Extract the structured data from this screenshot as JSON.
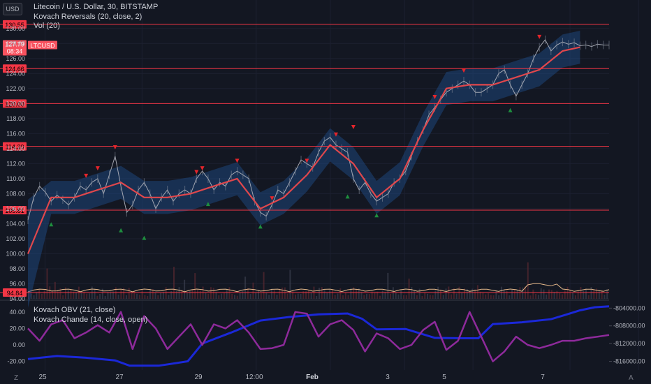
{
  "header": {
    "title": "Litecoin / U.S. Dollar, 30, BITSTAMP",
    "indicator1": "Kovach Reversals (20, close, 2)",
    "indicator2": "Vol (20)",
    "currency_button": "USD"
  },
  "lower_pane": {
    "indicator1": "Kovach OBV (21, close)",
    "indicator2": "Kovach Chande (14, close, open)"
  },
  "corner_buttons": {
    "left": "Z",
    "right": "A"
  },
  "colors": {
    "background": "#131722",
    "level_line": "#f23645",
    "band_fill": "#1f4f8f",
    "price_line": "#b2b5be",
    "ma_line": "#e0474c",
    "sell_marker": "#e5252b",
    "buy_marker": "#1e8e3e",
    "volume_line": "#e5b98a",
    "obv_line": "#1b28d8",
    "chande_line": "#8e2a9b"
  },
  "chart_data": [
    {
      "type": "line",
      "pane": "price",
      "symbol": "LTCUSD",
      "timeframe": "30",
      "x_tick_labels": [
        "25",
        "27",
        "29",
        "12:00",
        "Feb",
        "3",
        "5",
        "7"
      ],
      "y_tick_labels": [
        "94.00",
        "96.00",
        "98.00",
        "100.00",
        "102.00",
        "104.00",
        "106.00",
        "108.00",
        "110.00",
        "112.00",
        "114.00",
        "116.00",
        "118.00",
        "120.00",
        "122.00",
        "124.00",
        "126.00",
        "128.00",
        "130.00"
      ],
      "ylim": [
        94,
        131
      ],
      "price_label": {
        "value": "127.79",
        "countdown": "08:34",
        "symbol": "LTCUSD"
      },
      "levels": [
        130.55,
        124.66,
        120.0,
        114.3,
        105.81,
        94.84
      ],
      "level_labels": [
        "130.55",
        "124.66",
        "120.00",
        "114.30",
        "105.81",
        "94.84"
      ],
      "series": [
        {
          "kind": "close",
          "x": [
            0,
            2,
            4,
            6,
            8,
            10,
            12,
            14,
            16,
            18,
            20,
            22,
            24,
            26,
            28,
            30,
            32,
            34,
            36,
            38,
            40,
            42,
            44,
            46,
            48,
            50,
            52,
            54,
            56,
            58,
            60,
            62,
            64,
            66,
            68,
            70,
            72,
            74,
            76,
            78,
            80,
            82,
            84,
            86,
            88,
            90,
            92,
            94,
            96,
            98,
            100,
            102,
            104,
            106,
            108,
            110,
            112,
            114,
            116,
            118,
            120,
            122,
            124,
            126,
            128,
            130,
            132,
            134,
            136,
            138,
            140,
            142,
            144,
            146,
            148,
            150,
            152,
            154,
            156,
            158,
            160,
            162,
            164,
            166,
            168,
            170,
            172,
            174,
            176,
            178,
            180,
            182,
            184,
            186,
            188,
            190,
            192,
            194,
            196,
            198,
            200
          ],
          "values": [
            104.5,
            107.5,
            109.0,
            108.2,
            107.0,
            107.8,
            107.2,
            106.5,
            107.5,
            109.0,
            108.5,
            109.5,
            110.0,
            108.0,
            110.5,
            113.0,
            109.0,
            105.5,
            106.5,
            108.5,
            109.5,
            108.0,
            106.0,
            107.5,
            108.5,
            107.0,
            108.0,
            108.5,
            108.0,
            110.0,
            111.0,
            110.0,
            108.5,
            109.5,
            109.0,
            110.5,
            111.0,
            110.5,
            110.0,
            107.0,
            105.5,
            105.0,
            106.5,
            108.5,
            108.0,
            109.5,
            111.0,
            112.5,
            112.0,
            111.5,
            113.5,
            115.0,
            115.5,
            114.5,
            114.0,
            113.5,
            110.0,
            108.5,
            109.5,
            108.0,
            107.0,
            107.5,
            108.0,
            109.5,
            110.0,
            111.0,
            113.0,
            115.0,
            116.5,
            118.5,
            119.5,
            120.5,
            121.5,
            122.0,
            122.5,
            123.0,
            122.5,
            121.5,
            121.5,
            122.0,
            122.5,
            124.0,
            124.5,
            122.5,
            121.0,
            122.5,
            124.0,
            126.0,
            127.5,
            128.5,
            127.0,
            127.79,
            128.2,
            127.9,
            128.1,
            127.7,
            127.8,
            127.6,
            127.9,
            127.8,
            127.79
          ]
        },
        {
          "kind": "moving_average",
          "x": [
            0,
            8,
            16,
            24,
            32,
            40,
            48,
            56,
            64,
            72,
            80,
            88,
            96,
            104,
            112,
            120,
            128,
            136,
            144,
            152,
            160,
            168,
            176,
            184,
            190
          ],
          "values": [
            100.0,
            107.5,
            107.5,
            108.5,
            109.5,
            107.5,
            107.5,
            108.0,
            109.0,
            110.0,
            106.0,
            107.5,
            110.5,
            114.5,
            112.0,
            107.5,
            110.0,
            116.5,
            122.0,
            122.5,
            122.5,
            123.5,
            124.5,
            127.0,
            127.5
          ]
        }
      ],
      "sell_markers": [
        {
          "x": 20,
          "y": 110.0
        },
        {
          "x": 24,
          "y": 111.0
        },
        {
          "x": 30,
          "y": 113.8
        },
        {
          "x": 58,
          "y": 110.5
        },
        {
          "x": 60,
          "y": 111.0
        },
        {
          "x": 72,
          "y": 112.0
        },
        {
          "x": 84,
          "y": 107.0
        },
        {
          "x": 96,
          "y": 112.0
        },
        {
          "x": 106,
          "y": 115.5
        },
        {
          "x": 112,
          "y": 116.5
        },
        {
          "x": 140,
          "y": 120.5
        },
        {
          "x": 150,
          "y": 124.0
        },
        {
          "x": 176,
          "y": 128.5
        }
      ],
      "buy_markers": [
        {
          "x": 8,
          "y": 104.3
        },
        {
          "x": 32,
          "y": 103.5
        },
        {
          "x": 40,
          "y": 102.5
        },
        {
          "x": 62,
          "y": 107.0
        },
        {
          "x": 80,
          "y": 104.0
        },
        {
          "x": 110,
          "y": 108.0
        },
        {
          "x": 120,
          "y": 105.5
        },
        {
          "x": 166,
          "y": 119.5
        }
      ]
    },
    {
      "type": "line",
      "pane": "oscillator",
      "left_axis_ticks": [
        "40.00",
        "20.00",
        "0.00",
        "-20.00"
      ],
      "right_axis_ticks": [
        "-804000.00",
        "-808000.00",
        "-812000.00",
        "-816000.00"
      ],
      "left_ylim": [
        -28,
        50
      ],
      "right_ylim": [
        -817500,
        -803000
      ],
      "series": [
        {
          "name": "Kovach OBV (21, close)",
          "axis": "right",
          "x": [
            0,
            10,
            20,
            30,
            35,
            45,
            55,
            60,
            70,
            80,
            90,
            100,
            110,
            115,
            120,
            130,
            140,
            150,
            155,
            160,
            170,
            180,
            185,
            190,
            195,
            200
          ],
          "values": [
            -815500,
            -814800,
            -815200,
            -815800,
            -817000,
            -817000,
            -816000,
            -812000,
            -809500,
            -806800,
            -806000,
            -805400,
            -805200,
            -806400,
            -808800,
            -808700,
            -810700,
            -810800,
            -810800,
            -807600,
            -807200,
            -806500,
            -805500,
            -804500,
            -803800,
            -803600
          ]
        },
        {
          "name": "Kovach Chande (14, close, open)",
          "axis": "left",
          "x": [
            0,
            4,
            8,
            12,
            16,
            20,
            24,
            28,
            32,
            36,
            40,
            44,
            48,
            52,
            56,
            60,
            64,
            68,
            72,
            76,
            80,
            84,
            88,
            92,
            96,
            100,
            104,
            108,
            112,
            116,
            120,
            124,
            128,
            132,
            136,
            140,
            144,
            148,
            152,
            156,
            160,
            164,
            168,
            172,
            176,
            180,
            184,
            188,
            192,
            196,
            200
          ],
          "values": [
            20,
            5,
            25,
            30,
            8,
            15,
            24,
            15,
            40,
            -5,
            35,
            20,
            -5,
            10,
            25,
            0,
            25,
            20,
            30,
            15,
            -5,
            -4,
            0,
            40,
            38,
            10,
            25,
            30,
            18,
            -8,
            14,
            8,
            -5,
            0,
            18,
            28,
            -6,
            5,
            40,
            10,
            -20,
            -8,
            10,
            0,
            -4,
            0,
            5,
            5,
            8,
            10,
            12
          ]
        }
      ]
    }
  ]
}
